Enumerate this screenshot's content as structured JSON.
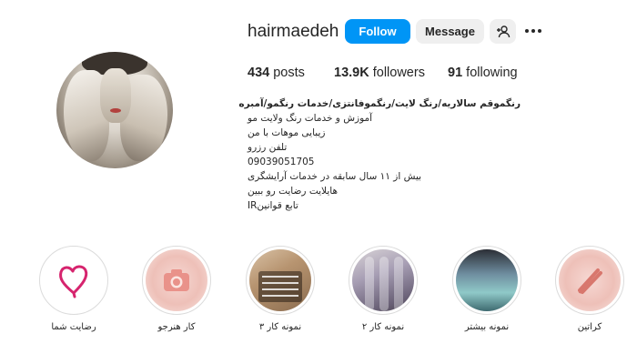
{
  "profile": {
    "username": "hairmaedeh",
    "follow_label": "Follow",
    "message_label": "Message"
  },
  "stats": {
    "posts_count": "434",
    "posts_label": "posts",
    "followers_count": "13.9K",
    "followers_label": "followers",
    "following_count": "91",
    "following_label": "following"
  },
  "bio": {
    "title": "رنگموقم سالاریه/رنگ لایت/رنگموفانتزی/خدمات رنگمو/آمبره",
    "lines": [
      "آموزش و خدمات رنگ ولایت مو",
      "زیبایی موهات با من",
      "تلفن رزرو",
      "09039051705",
      "بیش از ۱۱ سال سابقه در خدمات آرایشگری",
      "هایلایت رضایت رو ببین",
      "تابع قوانینIR"
    ]
  },
  "highlights": [
    {
      "label": "رضایت شما",
      "icon": "heart-icon"
    },
    {
      "label": "کار هنرجو",
      "icon": "camera-icon"
    },
    {
      "label": "نمونه کار ۳",
      "icon": "hair-photo"
    },
    {
      "label": "نمونه کار ۲",
      "icon": "hair-photo"
    },
    {
      "label": "نمونه بیشتر",
      "icon": "hair-photo"
    },
    {
      "label": "کراتین",
      "icon": "flat-iron-icon"
    }
  ],
  "colors": {
    "follow_button": "#0095f6",
    "secondary_button": "#efefef",
    "heart": "#d6246e"
  }
}
